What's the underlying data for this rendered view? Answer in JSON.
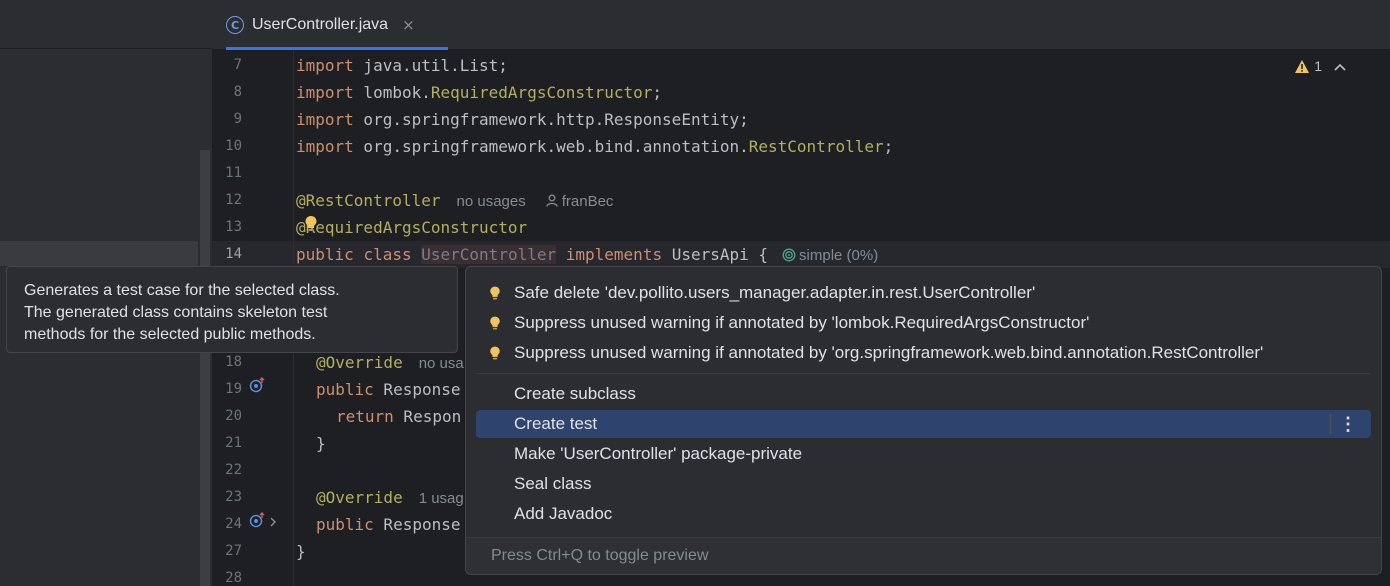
{
  "tab": {
    "icon_letter": "C",
    "file_name": "UserController.java",
    "close": "×"
  },
  "inspection": {
    "count": "1"
  },
  "lines": [
    {
      "num": "7"
    },
    {
      "num": "8"
    },
    {
      "num": "9"
    },
    {
      "num": "10"
    },
    {
      "num": "11"
    },
    {
      "num": "12"
    },
    {
      "num": "13"
    },
    {
      "num": "14"
    },
    {
      "num": "18"
    },
    {
      "num": "19"
    },
    {
      "num": "20"
    },
    {
      "num": "21"
    },
    {
      "num": "22"
    },
    {
      "num": "23"
    },
    {
      "num": "24"
    },
    {
      "num": "27"
    },
    {
      "num": "28"
    }
  ],
  "code": {
    "import": "import",
    "l7_rest": " java.util.List;",
    "l8_pkg": " lombok.",
    "l8_cls": "RequiredArgsConstructor",
    "l9_rest": " org.springframework.http.ResponseEntity;",
    "l10_pkg": " org.springframework.web.bind.annotation.",
    "l10_cls": "RestController",
    "semicolon": ";",
    "l12_ann": "@RestController",
    "l12_usages": "no usages",
    "l12_author": "franBec",
    "l13_ann": "@RequiredArgsConstructor",
    "l14_public": "public",
    "l14_class": "class",
    "l14_name": "UserController",
    "l14_impl": "implements",
    "l14_iface": " UsersApi {",
    "l14_complexity": "simple (0%)",
    "override": "@Override",
    "l18_usages": "no usa",
    "l19_public": "public",
    "l19_rest": " Response",
    "l20_return": "return",
    "l20_rest": " Respon",
    "l21": "}",
    "l23_usages": "1 usag",
    "l24_public": "public",
    "l24_rest": " Response",
    "l27": "}"
  },
  "tooltip": {
    "line1": "Generates a test case for the selected class.",
    "line2": "The generated class contains skeleton test",
    "line3": "methods for the selected public methods."
  },
  "popup": {
    "bulb_items": [
      {
        "label": "Safe delete 'dev.pollito.users_manager.adapter.in.rest.UserController'"
      },
      {
        "label": "Suppress unused warning if annotated by 'lombok.RequiredArgsConstructor'"
      },
      {
        "label": "Suppress unused warning if annotated by 'org.springframework.web.bind.annotation.RestController'"
      }
    ],
    "items": [
      {
        "label": "Create subclass"
      },
      {
        "label": "Create test"
      },
      {
        "label": "Make 'UserController' package-private"
      },
      {
        "label": "Seal class"
      },
      {
        "label": "Add Javadoc"
      }
    ],
    "more": "⋮",
    "footer": "Press Ctrl+Q to toggle preview"
  },
  "colors": {
    "accent": "#3574f0",
    "selection": "#2e436e",
    "bulb": "#f2c55c",
    "warning": "#f2c55c"
  }
}
